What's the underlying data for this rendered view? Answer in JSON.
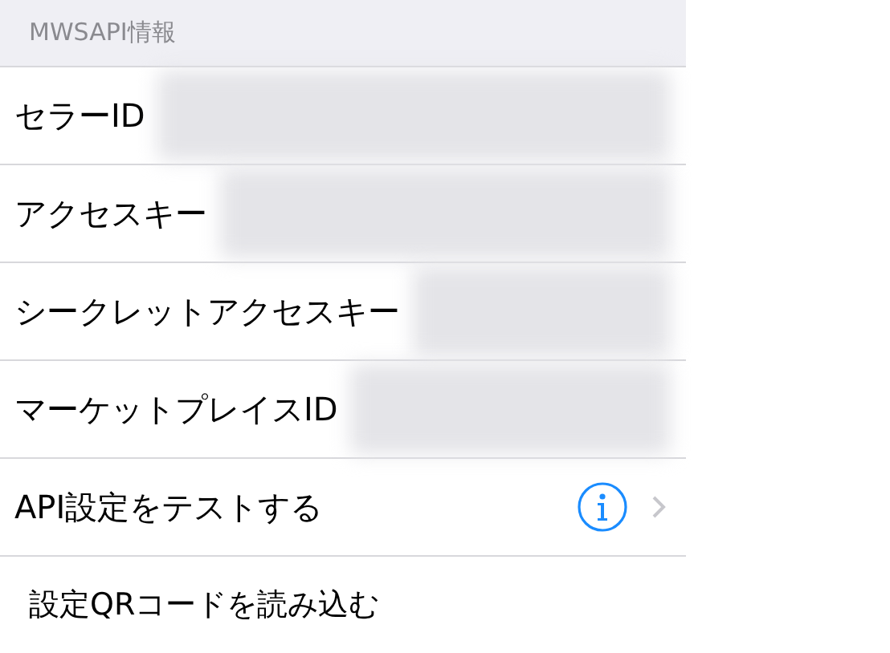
{
  "section_header": "MWSAPI情報",
  "rows": [
    {
      "kind": "field",
      "label": "セラーID"
    },
    {
      "kind": "field",
      "label": "アクセスキー"
    },
    {
      "kind": "field",
      "label": "シークレットアクセスキー"
    },
    {
      "kind": "field",
      "label": "マーケットプレイスID"
    },
    {
      "kind": "detail",
      "label": "API設定をテストする"
    },
    {
      "kind": "action",
      "label": "設定QRコードを読み込む"
    }
  ]
}
